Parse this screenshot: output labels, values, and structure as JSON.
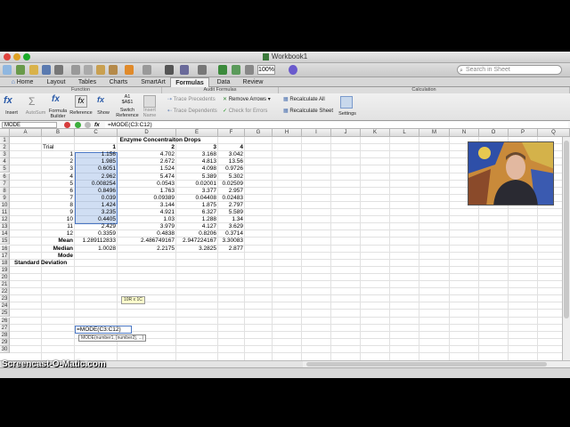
{
  "window": {
    "title": "Workbook1"
  },
  "toolbar": {
    "zoom": "100%",
    "search_placeholder": "Search in Sheet"
  },
  "tabs": [
    {
      "label": "Home"
    },
    {
      "label": "Layout"
    },
    {
      "label": "Tables"
    },
    {
      "label": "Charts"
    },
    {
      "label": "SmartArt"
    },
    {
      "label": "Formulas"
    },
    {
      "label": "Data"
    },
    {
      "label": "Review"
    }
  ],
  "ribbon": {
    "groups": {
      "function": "Function",
      "audit": "Audit Formulas",
      "calc": "Calculation"
    },
    "insert": "Insert",
    "autosum": "AutoSum",
    "formula_builder_1": "Formula",
    "formula_builder_2": "Builder",
    "reference": "Reference",
    "show": "Show",
    "switch_1": "Switch",
    "switch_2": "Reference",
    "insert_name_1": "Insert",
    "insert_name_2": "Name",
    "switch_glyph": "A1\n$A$1",
    "trace_precedents": "Trace Precedents",
    "remove_arrows": "Remove Arrows",
    "trace_dependents": "Trace Dependents",
    "check_errors": "Check for Errors",
    "recalc_all": "Recalculate All",
    "recalc_sheet": "Recalculate Sheet",
    "settings": "Settings"
  },
  "formula_bar": {
    "name_box": "MODE",
    "fx": "fx",
    "formula": "=MODE(C3:C12)"
  },
  "columns": [
    "A",
    "B",
    "C",
    "D",
    "E",
    "F",
    "G",
    "H",
    "I",
    "J",
    "K",
    "L",
    "M",
    "N",
    "O",
    "P",
    "Q"
  ],
  "rows": [
    "1",
    "2",
    "3",
    "4",
    "5",
    "6",
    "7",
    "8",
    "9",
    "10",
    "11",
    "12",
    "13",
    "14",
    "15",
    "16",
    "17",
    "18",
    "19",
    "20",
    "21",
    "22",
    "23",
    "24",
    "25",
    "26",
    "27",
    "28",
    "29",
    "30"
  ],
  "sheet": {
    "table_title": "Enzyme Concentraiton Drops",
    "trial_label": "Trial",
    "col_headers": [
      "1",
      "2",
      "3",
      "4"
    ],
    "trials": [
      "1",
      "2",
      "3",
      "4",
      "5",
      "6",
      "7",
      "8",
      "9",
      "10",
      "11",
      "12"
    ],
    "data": [
      [
        "1.156",
        "4.702",
        "3.168",
        "3.042"
      ],
      [
        "1.985",
        "2.672",
        "4.813",
        "13.56"
      ],
      [
        "0.6051",
        "1.524",
        "4.098",
        "0.9726"
      ],
      [
        "2.962",
        "5.474",
        "5.389",
        "5.302"
      ],
      [
        "0.008254",
        "0.0543",
        "0.02001",
        "0.02509"
      ],
      [
        "0.8496",
        "1.763",
        "3.377",
        "2.957"
      ],
      [
        "0.039",
        "0.09389",
        "0.04408",
        "0.02483"
      ],
      [
        "1.424",
        "3.144",
        "1.875",
        "2.797"
      ],
      [
        "3.235",
        "4.921",
        "6.327",
        "5.589"
      ],
      [
        "0.4405",
        "1.03",
        "1.288",
        "1.34"
      ],
      [
        "2.429",
        "3.979",
        "4.127",
        "3.629"
      ],
      [
        "0.3359",
        "0.4838",
        "0.8206",
        "0.3714"
      ]
    ],
    "mean_label": "Mean",
    "mean": [
      "1.289112833",
      "2.486749167",
      "2.947224167",
      "3.30083"
    ],
    "median_label": "Median",
    "median": [
      "1.0028",
      "2.2175",
      "3.2825",
      "2.877"
    ],
    "mode_label": "Mode",
    "mode_edit": "=MODE(C3:C12)",
    "std_label": "Standard Deviation",
    "range_tip": "10R x 1C",
    "fn_hint": "MODE(number1, [number2], ...)"
  },
  "watermark": "Screencast-O-Matic.com"
}
